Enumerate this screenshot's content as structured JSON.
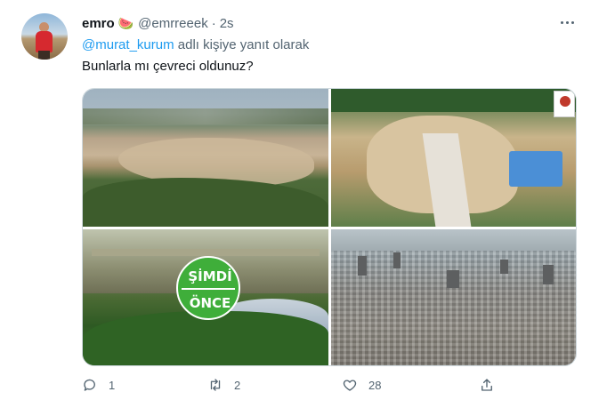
{
  "tweet": {
    "author_name": "emro",
    "author_emoji": "🍉",
    "handle": "@emrreeek",
    "separator": "·",
    "time": "2s",
    "reply_prefix": "",
    "reply_mention": "@murat_kurum",
    "reply_suffix": " adlı kişiye yanıt olarak",
    "text": "Bunlarla mı çevreci oldunuz?"
  },
  "media": {
    "overlay_top": "ŞİMDİ",
    "overlay_bottom": "ÖNCE"
  },
  "actions": {
    "reply_count": "1",
    "retweet_count": "2",
    "like_count": "28"
  },
  "icons": {
    "more": "more-dots-icon",
    "reply": "reply-icon",
    "retweet": "retweet-icon",
    "like": "heart-icon",
    "share": "share-icon"
  },
  "colors": {
    "accent": "#1d9bf0",
    "secondary_text": "#536471",
    "primary_text": "#0f1419",
    "overlay_green": "#3fae3a"
  }
}
